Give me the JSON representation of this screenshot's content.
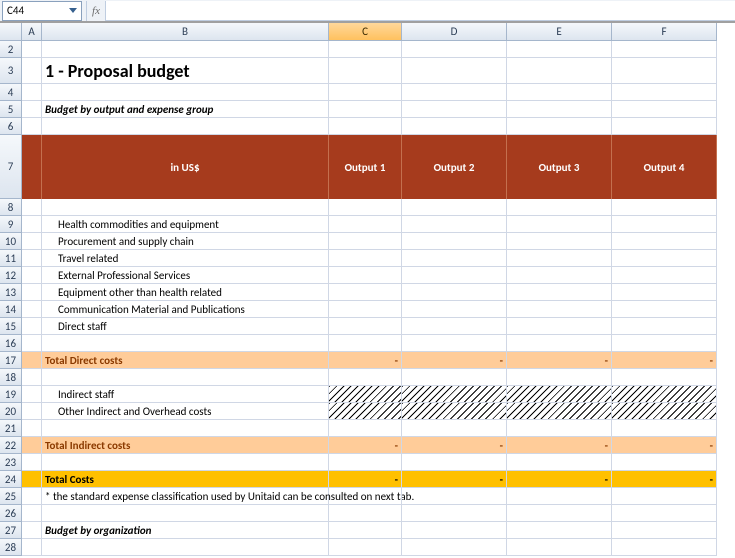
{
  "namebox": "C44",
  "fx": "fx",
  "formula": "",
  "columns": [
    "A",
    "B",
    "C",
    "D",
    "E",
    "F"
  ],
  "selectedCol": "C",
  "rows": [
    "2",
    "3",
    "4",
    "5",
    "6",
    "7",
    "8",
    "9",
    "10",
    "11",
    "12",
    "13",
    "14",
    "15",
    "16",
    "17",
    "18",
    "19",
    "20",
    "21",
    "22",
    "23",
    "24",
    "25",
    "26",
    "27",
    "28"
  ],
  "title": "1 - Proposal budget",
  "subtitle": "Budget by output and expense group",
  "headers": {
    "main": "in US$",
    "outputs": [
      "Output 1",
      "Output 2",
      "Output 3",
      "Output 4"
    ]
  },
  "directItems": [
    "Health commodities and equipment",
    "Procurement and supply chain",
    "Travel related",
    "External Professional Services",
    "Equipment other than health related",
    "Communication Material and  Publications",
    "Direct staff"
  ],
  "totals": {
    "direct": "Total Direct costs",
    "indirect": "Total Indirect costs",
    "all": "Total Costs",
    "dash": "-"
  },
  "indirectItems": [
    "Indirect staff",
    "Other Indirect and Overhead costs"
  ],
  "footnote": "* the standard expense classification used by Unitaid can be consulted on next tab.",
  "section2": "Budget by organization",
  "chart_data": {
    "type": "table",
    "title": "1 - Proposal budget",
    "columns": [
      "in US$",
      "Output 1",
      "Output 2",
      "Output 3",
      "Output 4"
    ],
    "rows": [
      {
        "label": "Health commodities and equipment",
        "values": [
          null,
          null,
          null,
          null
        ]
      },
      {
        "label": "Procurement and supply chain",
        "values": [
          null,
          null,
          null,
          null
        ]
      },
      {
        "label": "Travel related",
        "values": [
          null,
          null,
          null,
          null
        ]
      },
      {
        "label": "External Professional Services",
        "values": [
          null,
          null,
          null,
          null
        ]
      },
      {
        "label": "Equipment other than health related",
        "values": [
          null,
          null,
          null,
          null
        ]
      },
      {
        "label": "Communication Material and  Publications",
        "values": [
          null,
          null,
          null,
          null
        ]
      },
      {
        "label": "Direct staff",
        "values": [
          null,
          null,
          null,
          null
        ]
      },
      {
        "label": "Total Direct costs",
        "values": [
          "-",
          "-",
          "-",
          "-"
        ]
      },
      {
        "label": "Indirect staff",
        "values": [
          null,
          null,
          null,
          null
        ]
      },
      {
        "label": "Other Indirect and Overhead costs",
        "values": [
          null,
          null,
          null,
          null
        ]
      },
      {
        "label": "Total Indirect costs",
        "values": [
          "-",
          "-",
          "-",
          "-"
        ]
      },
      {
        "label": "Total Costs",
        "values": [
          "-",
          "-",
          "-",
          "-"
        ]
      }
    ]
  }
}
